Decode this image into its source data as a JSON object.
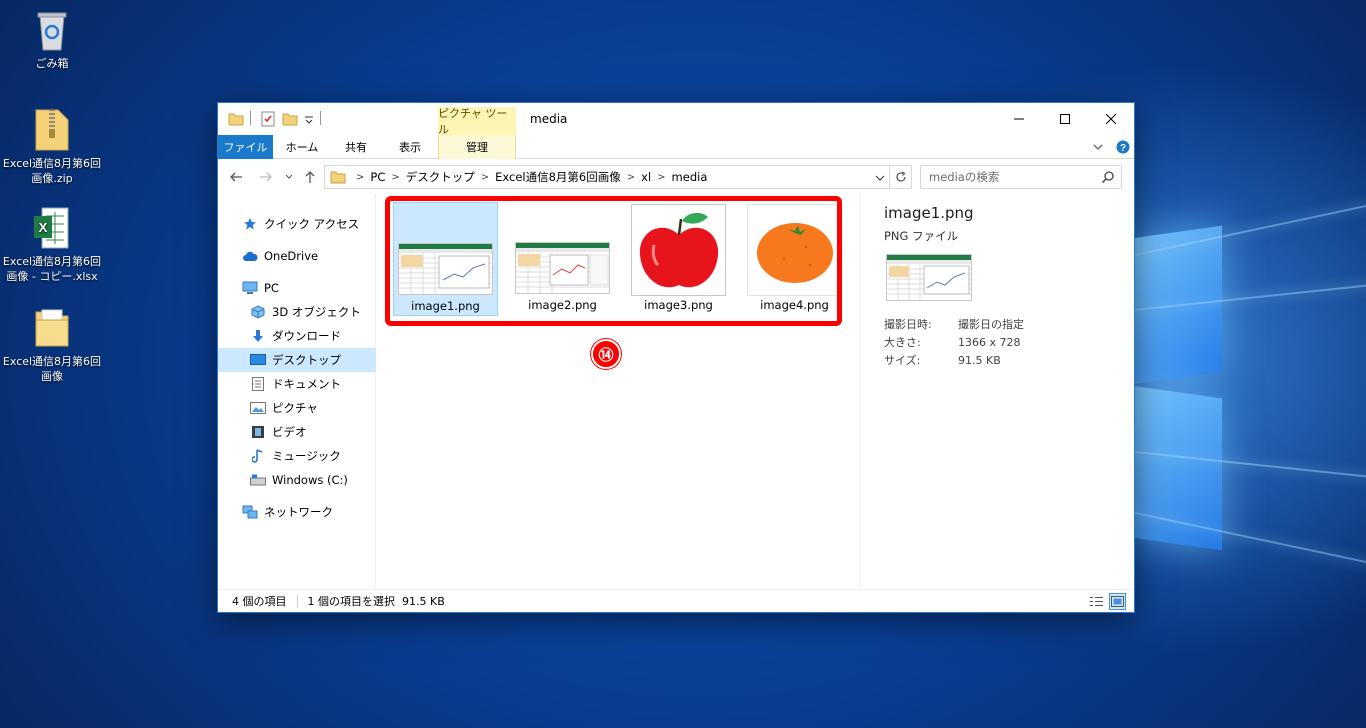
{
  "desktop": {
    "icons": [
      {
        "label": "ごみ箱",
        "icon": "recycle-bin-icon"
      },
      {
        "label": "Excel通信8月第6回\n画像.zip",
        "icon": "zip-folder-icon"
      },
      {
        "label": "Excel通信8月第6回\n画像 - コピー.xlsx",
        "icon": "excel-file-icon"
      },
      {
        "label": "Excel通信8月第6回\n画像",
        "icon": "folder-icon"
      }
    ]
  },
  "window": {
    "title": "media",
    "context_tab_title": "ピクチャ ツール",
    "caption_buttons": {
      "minimize": "minimize-icon",
      "maximize": "maximize-icon",
      "close": "close-icon"
    }
  },
  "ribbon": {
    "tabs": [
      "ファイル",
      "ホーム",
      "共有",
      "表示",
      "管理"
    ]
  },
  "address": {
    "breadcrumbs": [
      "PC",
      "デスクトップ",
      "Excel通信8月第6回画像",
      "xl",
      "media"
    ]
  },
  "search": {
    "placeholder": "mediaの検索"
  },
  "nav": {
    "items": [
      {
        "label": "クイック アクセス",
        "icon": "star-icon"
      },
      {
        "label": "OneDrive",
        "icon": "cloud-icon"
      },
      {
        "label": "PC",
        "icon": "computer-icon"
      },
      {
        "label": "3D オブジェクト",
        "icon": "cube-icon"
      },
      {
        "label": "ダウンロード",
        "icon": "download-arrow-icon"
      },
      {
        "label": "デスクトップ",
        "icon": "desktop-icon",
        "selected": true
      },
      {
        "label": "ドキュメント",
        "icon": "document-icon"
      },
      {
        "label": "ピクチャ",
        "icon": "picture-icon"
      },
      {
        "label": "ビデオ",
        "icon": "video-icon"
      },
      {
        "label": "ミュージック",
        "icon": "music-note-icon"
      },
      {
        "label": "Windows (C:)",
        "icon": "drive-icon"
      },
      {
        "label": "ネットワーク",
        "icon": "network-icon"
      }
    ]
  },
  "files": [
    {
      "name": "image1.png",
      "thumb": "spreadsheet",
      "selected": true
    },
    {
      "name": "image2.png",
      "thumb": "spreadsheet-chart"
    },
    {
      "name": "image3.png",
      "thumb": "apple"
    },
    {
      "name": "image4.png",
      "thumb": "orange"
    }
  ],
  "annotation": {
    "step": "⑭",
    "highlight_color": "#ff0000"
  },
  "details": {
    "name": "image1.png",
    "type": "PNG ファイル",
    "rows": [
      {
        "key": "撮影日時:",
        "value": "撮影日の指定"
      },
      {
        "key": "大きさ:",
        "value": "1366 x 728"
      },
      {
        "key": "サイズ:",
        "value": "91.5 KB"
      }
    ]
  },
  "status": {
    "item_count": "4 個の項目",
    "selection": "1 個の項目を選択  91.5 KB"
  },
  "colors": {
    "accent": "#1979ca",
    "selection": "#cce8ff",
    "context_tab": "#fdf5b3"
  }
}
